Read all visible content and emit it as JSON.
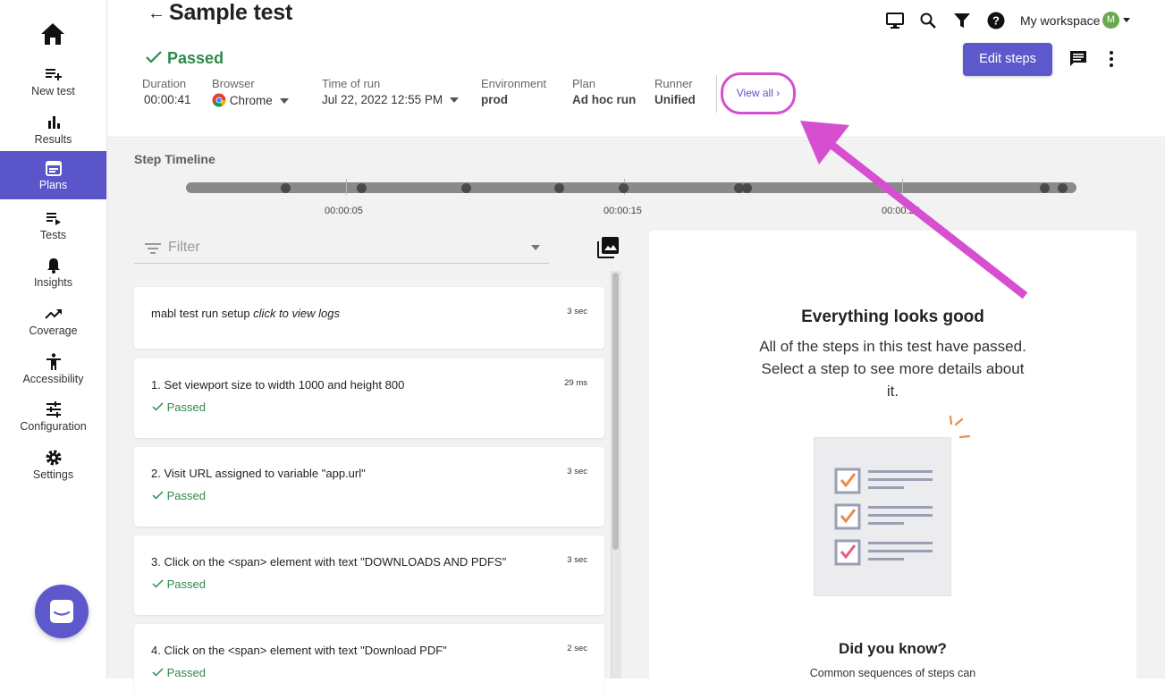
{
  "sidebar": {
    "items": [
      {
        "label": "New test",
        "icon": "playlist-add-icon"
      },
      {
        "label": "Results",
        "icon": "bar-chart-icon"
      },
      {
        "label": "Plans",
        "icon": "calendar-icon",
        "active": true
      },
      {
        "label": "Tests",
        "icon": "playlist-play-icon"
      },
      {
        "label": "Insights",
        "icon": "bell-icon"
      },
      {
        "label": "Coverage",
        "icon": "trending-up-icon"
      },
      {
        "label": "Accessibility",
        "icon": "accessibility-icon"
      },
      {
        "label": "Configuration",
        "icon": "tune-icon"
      },
      {
        "label": "Settings",
        "icon": "gear-icon"
      }
    ],
    "accent": "#5a55c9"
  },
  "header": {
    "back": "←",
    "title": "Sample test",
    "status": "Passed",
    "status_color": "#2f8a4a",
    "meta": {
      "duration_label": "Duration",
      "duration": "00:00:41",
      "browser_label": "Browser",
      "browser": "Chrome",
      "time_label": "Time of run",
      "time": "Jul 22, 2022 12:55 PM",
      "env_label": "Environment",
      "env": "prod",
      "plan_label": "Plan",
      "plan": "Ad hoc run",
      "runner_label": "Runner",
      "runner": "Unified"
    },
    "view_all": "View all",
    "workspace": "My workspace",
    "avatar": "M",
    "edit_steps": "Edit steps"
  },
  "timeline": {
    "title": "Step Timeline",
    "labels": [
      "00:00:05",
      "00:00:15",
      "00:00:25"
    ]
  },
  "filter": {
    "placeholder": "Filter"
  },
  "steps": [
    {
      "name_main": "mabl test run setup ",
      "name_italic": "click to view logs",
      "duration": "3 sec",
      "status": ""
    },
    {
      "name_main": "1. Set viewport size to width 1000 and height 800",
      "name_italic": "",
      "duration": "29 ms",
      "status": "Passed"
    },
    {
      "name_main": "2. Visit URL assigned to variable \"app.url\"",
      "name_italic": "",
      "duration": "3 sec",
      "status": "Passed"
    },
    {
      "name_main": "3. Click on the <span> element with text \"DOWNLOADS AND PDFS\"",
      "name_italic": "",
      "duration": "3 sec",
      "status": "Passed"
    },
    {
      "name_main": "4. Click on the <span> element with text \"Download PDF\"",
      "name_italic": "",
      "duration": "2 sec",
      "status": "Passed"
    }
  ],
  "panel": {
    "heading": "Everything looks good",
    "body": "All of the steps in this test have passed. Select a step to see more details about it.",
    "did_you_know": "Did you know?",
    "tip": "Common sequences of steps can"
  },
  "annotation_color": "#d64fd1"
}
